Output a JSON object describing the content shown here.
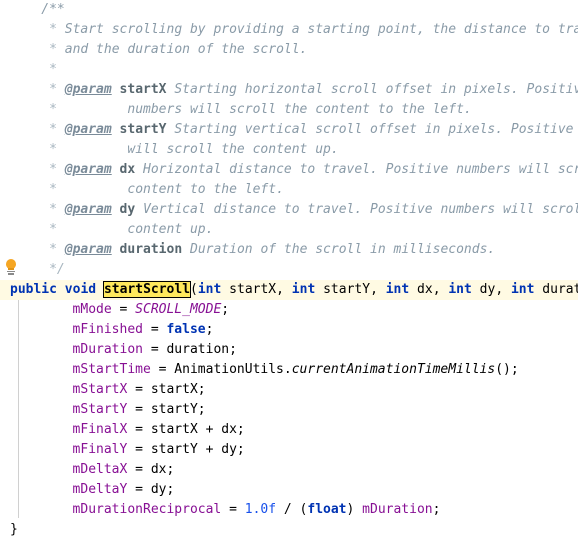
{
  "editor": {
    "app": "code-editor",
    "language": "Java",
    "background": "#ffffff",
    "current_line_background": "#fffae3",
    "highlight_color": "#ffe95c",
    "indent_guide_color": "#d0d0d0",
    "gutter_icon": "lightbulb-intention-icon",
    "font_size_px": 13,
    "line_height_px": 20,
    "highlighted_identifier": "startScroll",
    "colors": {
      "comment": "#8a9ba8",
      "javadoc_tag": "#7a8b99",
      "keyword": "#0033b3",
      "field": "#871094",
      "number": "#1750eb",
      "plain_text": "#000000"
    },
    "lines": [
      {
        "indent": 1,
        "parts": [
          {
            "t": "cmt",
            "s": "/**"
          }
        ]
      },
      {
        "indent": 1,
        "parts": [
          {
            "t": "cmt-star",
            "s": " * "
          },
          {
            "t": "cmt",
            "s": "Start scrolling by providing a starting point, the distance to travel,"
          }
        ]
      },
      {
        "indent": 1,
        "parts": [
          {
            "t": "cmt-star",
            "s": " * "
          },
          {
            "t": "cmt",
            "s": "and the duration of the scroll."
          }
        ]
      },
      {
        "indent": 1,
        "parts": [
          {
            "t": "cmt-star",
            "s": " *"
          }
        ]
      },
      {
        "indent": 1,
        "parts": [
          {
            "t": "cmt-star",
            "s": " * "
          },
          {
            "t": "tag",
            "s": "@param"
          },
          {
            "t": "cmt",
            "s": " "
          },
          {
            "t": "tagval",
            "s": "startX"
          },
          {
            "t": "cmt",
            "s": " Starting horizontal scroll offset in pixels. Positive"
          }
        ]
      },
      {
        "indent": 1,
        "parts": [
          {
            "t": "cmt-star",
            "s": " * "
          },
          {
            "t": "cmt",
            "s": "        numbers will scroll the content to the left."
          }
        ]
      },
      {
        "indent": 1,
        "parts": [
          {
            "t": "cmt-star",
            "s": " * "
          },
          {
            "t": "tag",
            "s": "@param"
          },
          {
            "t": "cmt",
            "s": " "
          },
          {
            "t": "tagval",
            "s": "startY"
          },
          {
            "t": "cmt",
            "s": " Starting vertical scroll offset in pixels. Positive numbers"
          }
        ]
      },
      {
        "indent": 1,
        "parts": [
          {
            "t": "cmt-star",
            "s": " * "
          },
          {
            "t": "cmt",
            "s": "        will scroll the content up."
          }
        ]
      },
      {
        "indent": 1,
        "parts": [
          {
            "t": "cmt-star",
            "s": " * "
          },
          {
            "t": "tag",
            "s": "@param"
          },
          {
            "t": "cmt",
            "s": " "
          },
          {
            "t": "tagval",
            "s": "dx"
          },
          {
            "t": "cmt",
            "s": " Horizontal distance to travel. Positive numbers will scroll the"
          }
        ]
      },
      {
        "indent": 1,
        "parts": [
          {
            "t": "cmt-star",
            "s": " * "
          },
          {
            "t": "cmt",
            "s": "        content to the left."
          }
        ]
      },
      {
        "indent": 1,
        "parts": [
          {
            "t": "cmt-star",
            "s": " * "
          },
          {
            "t": "tag",
            "s": "@param"
          },
          {
            "t": "cmt",
            "s": " "
          },
          {
            "t": "tagval",
            "s": "dy"
          },
          {
            "t": "cmt",
            "s": " Vertical distance to travel. Positive numbers will scroll the"
          }
        ]
      },
      {
        "indent": 1,
        "parts": [
          {
            "t": "cmt-star",
            "s": " * "
          },
          {
            "t": "cmt",
            "s": "        content up."
          }
        ]
      },
      {
        "indent": 1,
        "parts": [
          {
            "t": "cmt-star",
            "s": " * "
          },
          {
            "t": "tag",
            "s": "@param"
          },
          {
            "t": "cmt",
            "s": " "
          },
          {
            "t": "tagval",
            "s": "duration"
          },
          {
            "t": "cmt",
            "s": " Duration of the scroll in milliseconds."
          }
        ]
      },
      {
        "indent": 1,
        "parts": [
          {
            "t": "cmt-star",
            "s": " */"
          }
        ]
      },
      {
        "indent": 0,
        "current": true,
        "parts": [
          {
            "t": "kw",
            "s": "public"
          },
          {
            "t": "plain",
            "s": " "
          },
          {
            "t": "kw",
            "s": "void"
          },
          {
            "t": "plain",
            "s": " "
          },
          {
            "t": "hl-ident",
            "s": "startScroll"
          },
          {
            "t": "plain",
            "s": "("
          },
          {
            "t": "kw",
            "s": "int"
          },
          {
            "t": "plain",
            "s": " startX, "
          },
          {
            "t": "kw",
            "s": "int"
          },
          {
            "t": "plain",
            "s": " startY, "
          },
          {
            "t": "kw",
            "s": "int"
          },
          {
            "t": "plain",
            "s": " dx, "
          },
          {
            "t": "kw",
            "s": "int"
          },
          {
            "t": "plain",
            "s": " dy, "
          },
          {
            "t": "kw",
            "s": "int"
          },
          {
            "t": "plain",
            "s": " duration) {"
          }
        ]
      },
      {
        "indent": 2,
        "parts": [
          {
            "t": "field",
            "s": "mMode"
          },
          {
            "t": "plain",
            "s": " = "
          },
          {
            "t": "sfield",
            "s": "SCROLL_MODE"
          },
          {
            "t": "plain",
            "s": ";"
          }
        ]
      },
      {
        "indent": 2,
        "parts": [
          {
            "t": "field",
            "s": "mFinished"
          },
          {
            "t": "plain",
            "s": " = "
          },
          {
            "t": "kw",
            "s": "false"
          },
          {
            "t": "plain",
            "s": ";"
          }
        ]
      },
      {
        "indent": 2,
        "parts": [
          {
            "t": "field",
            "s": "mDuration"
          },
          {
            "t": "plain",
            "s": " = duration;"
          }
        ]
      },
      {
        "indent": 2,
        "parts": [
          {
            "t": "field",
            "s": "mStartTime"
          },
          {
            "t": "plain",
            "s": " = AnimationUtils."
          },
          {
            "t": "smeth",
            "s": "currentAnimationTimeMillis"
          },
          {
            "t": "plain",
            "s": "();"
          }
        ]
      },
      {
        "indent": 2,
        "parts": [
          {
            "t": "field",
            "s": "mStartX"
          },
          {
            "t": "plain",
            "s": " = startX;"
          }
        ]
      },
      {
        "indent": 2,
        "parts": [
          {
            "t": "field",
            "s": "mStartY"
          },
          {
            "t": "plain",
            "s": " = startY;"
          }
        ]
      },
      {
        "indent": 2,
        "parts": [
          {
            "t": "field",
            "s": "mFinalX"
          },
          {
            "t": "plain",
            "s": " = startX + dx;"
          }
        ]
      },
      {
        "indent": 2,
        "parts": [
          {
            "t": "field",
            "s": "mFinalY"
          },
          {
            "t": "plain",
            "s": " = startY + dy;"
          }
        ]
      },
      {
        "indent": 2,
        "parts": [
          {
            "t": "field",
            "s": "mDeltaX"
          },
          {
            "t": "plain",
            "s": " = dx;"
          }
        ]
      },
      {
        "indent": 2,
        "parts": [
          {
            "t": "field",
            "s": "mDeltaY"
          },
          {
            "t": "plain",
            "s": " = dy;"
          }
        ]
      },
      {
        "indent": 2,
        "parts": [
          {
            "t": "field",
            "s": "mDurationReciprocal"
          },
          {
            "t": "plain",
            "s": " = "
          },
          {
            "t": "num",
            "s": "1.0f"
          },
          {
            "t": "plain",
            "s": " / ("
          },
          {
            "t": "kw",
            "s": "float"
          },
          {
            "t": "plain",
            "s": ") "
          },
          {
            "t": "field",
            "s": "mDuration"
          },
          {
            "t": "plain",
            "s": ";"
          }
        ]
      },
      {
        "indent": 0,
        "parts": [
          {
            "t": "plain",
            "s": "}"
          }
        ]
      }
    ]
  }
}
